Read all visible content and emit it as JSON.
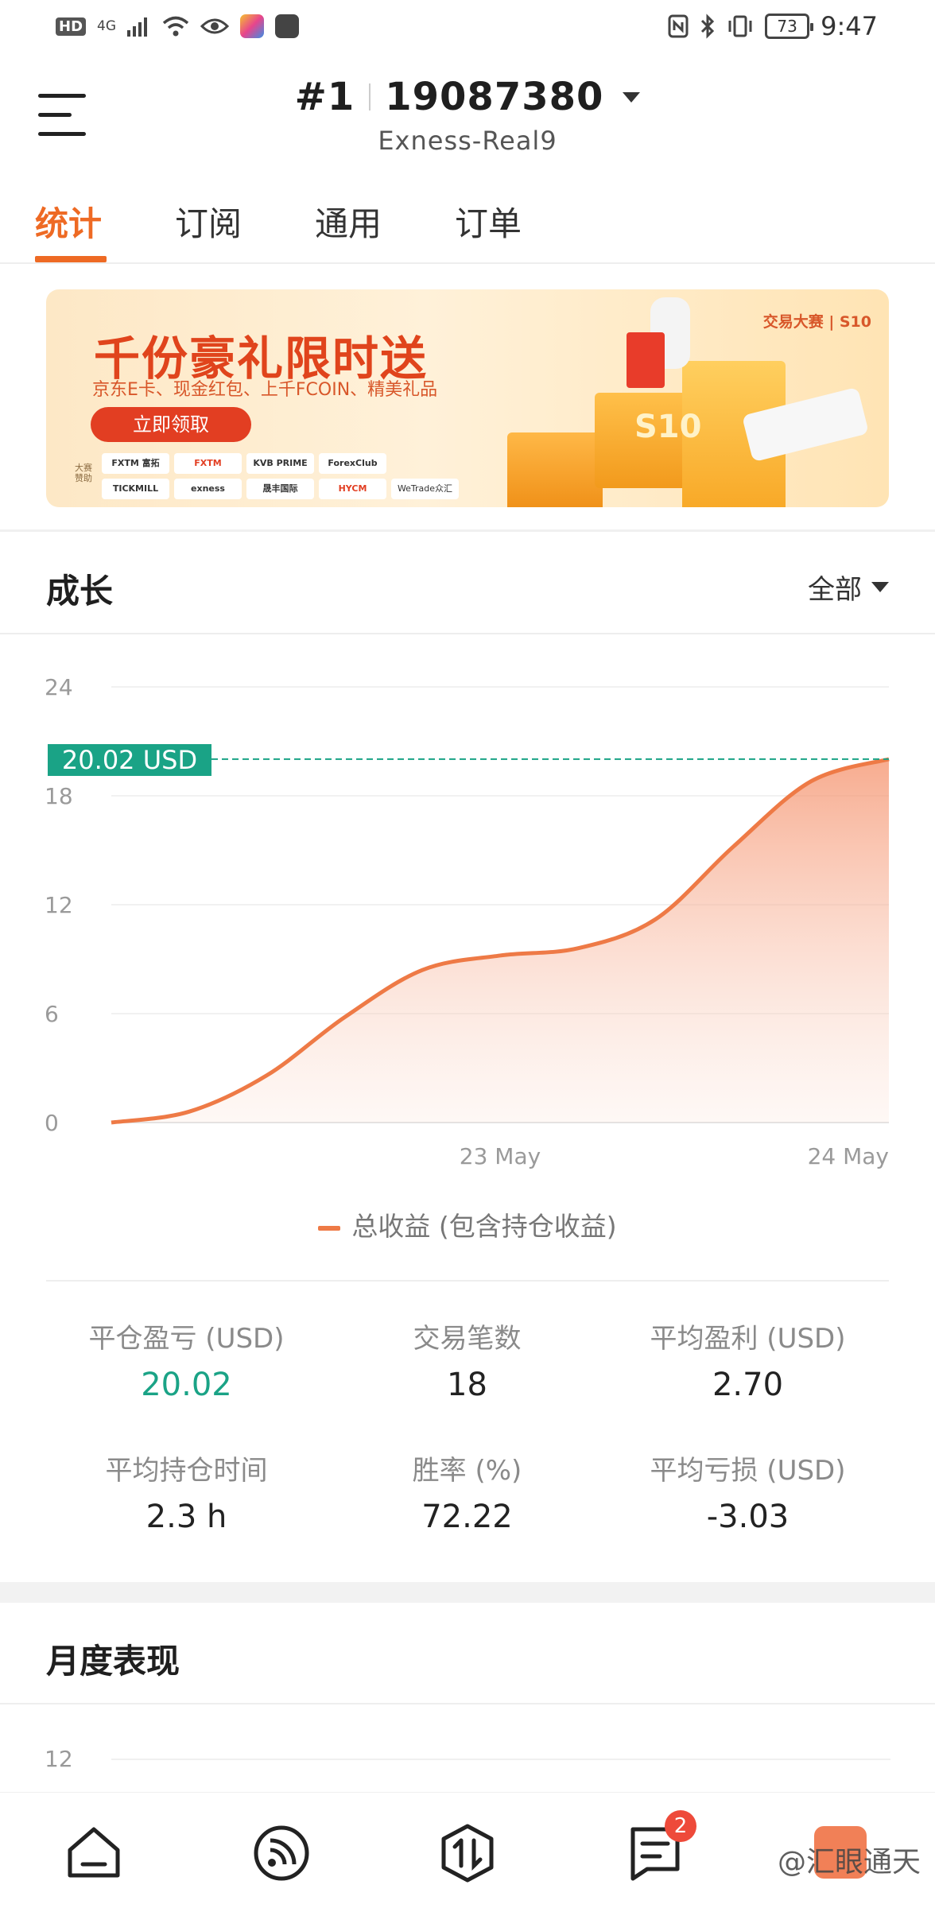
{
  "status_bar": {
    "left_badges": [
      "HD",
      "4G"
    ],
    "battery": "73",
    "time": "9:47"
  },
  "header": {
    "rank": "#1",
    "account_number": "19087380",
    "server": "Exness-Real9"
  },
  "tabs": [
    {
      "label": "统计",
      "active": true
    },
    {
      "label": "订阅",
      "active": false
    },
    {
      "label": "通用",
      "active": false
    },
    {
      "label": "订单",
      "active": false
    }
  ],
  "banner": {
    "title": "千份豪礼限时送",
    "subtitle": "京东E卡、现金红包、上千FCOIN、精美礼品",
    "button": "立即领取",
    "sponsor_label": "大赛赞助",
    "brand": "交易大赛 | S10",
    "sponsors": [
      "FXTM 富拓",
      "FXTM",
      "KVB PRIME",
      "ForexClub",
      "",
      "TICKMILL",
      "exness",
      "晟丰国际",
      "HYCM",
      "WeTrade众汇"
    ]
  },
  "growth": {
    "title": "成长",
    "filter": "全部",
    "current_tag": "20.02 USD",
    "legend": "总收益 (包含持仓收益)"
  },
  "chart_data": {
    "type": "area",
    "x_labels": [
      "23 May",
      "24 May"
    ],
    "y_ticks": [
      "24",
      "18",
      "12",
      "6",
      "0"
    ],
    "ylim": [
      0,
      24
    ],
    "series": [
      {
        "name": "总收益 (包含持仓收益)",
        "color": "#ee7a46",
        "x": [
          0,
          0.1,
          0.2,
          0.3,
          0.4,
          0.5,
          0.6,
          0.7,
          0.8,
          0.9,
          1.0
        ],
        "values": [
          0,
          0.6,
          2.6,
          5.8,
          8.4,
          9.2,
          9.6,
          11.2,
          15.2,
          18.8,
          20.02
        ]
      }
    ],
    "x_label_positions": [
      0.5,
      1.0
    ]
  },
  "stats": [
    {
      "label": "平仓盈亏 (USD)",
      "value": "20.02",
      "color": "green"
    },
    {
      "label": "交易笔数",
      "value": "18"
    },
    {
      "label": "平均盈利 (USD)",
      "value": "2.70"
    },
    {
      "label": "平均持仓时间",
      "value": "2.3 h"
    },
    {
      "label": "胜率 (%)",
      "value": "72.22"
    },
    {
      "label": "平均亏损 (USD)",
      "value": "-3.03"
    }
  ],
  "monthly": {
    "title": "月度表现",
    "y_top": "12"
  },
  "bottom_nav": {
    "items": [
      "home-icon",
      "feed-icon",
      "trade-icon",
      "messages-icon",
      "profile-icon"
    ],
    "message_badge": "2"
  },
  "watermark": "@汇眼通天"
}
